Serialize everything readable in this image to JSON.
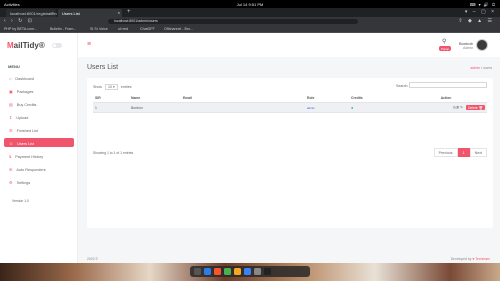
{
  "system": {
    "activities": "Activities",
    "tab_label": "Brave Web Browser",
    "clock": "Jul 14  9:51 PM",
    "tray": "⌨ ▾ 🔊 ⏻"
  },
  "browser": {
    "tabs": [
      {
        "label": "localhost:8001/registration"
      },
      {
        "label": "Users List"
      }
    ],
    "url": "localhost:8001/admin/users",
    "bookmarks": [
      "PHP by BETA.com...",
      "Bulletin - Fram...",
      "SI Sr Voice",
      "ul>red",
      "ChatGPT",
      "Offchannel - Bro..."
    ]
  },
  "app": {
    "brand_prefix": "M",
    "brand_name": "ailTidy®",
    "menu_title": "MENU",
    "menu": [
      {
        "label": "Dashboard",
        "icon": "home-icon"
      },
      {
        "label": "Packages",
        "icon": "package-icon"
      },
      {
        "label": "Buy Credits",
        "icon": "cart-icon"
      },
      {
        "label": "Upload",
        "icon": "upload-icon"
      },
      {
        "label": "Finished List",
        "icon": "list-icon"
      },
      {
        "label": "Users List",
        "icon": "users-icon",
        "active": true
      },
      {
        "label": "Payment History",
        "icon": "payment-icon"
      },
      {
        "label": "Auto Responders",
        "icon": "responder-icon"
      },
      {
        "label": "Settings",
        "icon": "gear-icon"
      }
    ],
    "version": "Version 1.0",
    "user": {
      "name": "Bonbob",
      "role": "Admin",
      "badge": "Popup"
    },
    "heading": "Users List",
    "breadcrumb": {
      "parent": "admin",
      "current": "users"
    },
    "show_label": "Show",
    "entries_value": "10",
    "entries_label": "entries",
    "search_label": "Search:",
    "columns": [
      "SIR",
      "Name",
      "Email",
      "Role",
      "Credits",
      "Action"
    ],
    "rows": [
      {
        "sir": "1",
        "name": "Bonbon",
        "email": "",
        "role": "admin",
        "credits": "●",
        "edit": "Edit ✎",
        "delete": "Delete 🗑"
      }
    ],
    "showing": "Showing 1 to 1 of 1 entries",
    "pagination": {
      "prev": "Previous",
      "page": "1",
      "next": "Next"
    },
    "footer_left": "2023 ©",
    "footer_right_prefix": "Developed by ",
    "footer_right_brand": "♥ Techmarx"
  },
  "colors": {
    "accent": "#f1556c",
    "sidebar_bg": "#ffffff",
    "page_bg": "#f5f6f8"
  }
}
